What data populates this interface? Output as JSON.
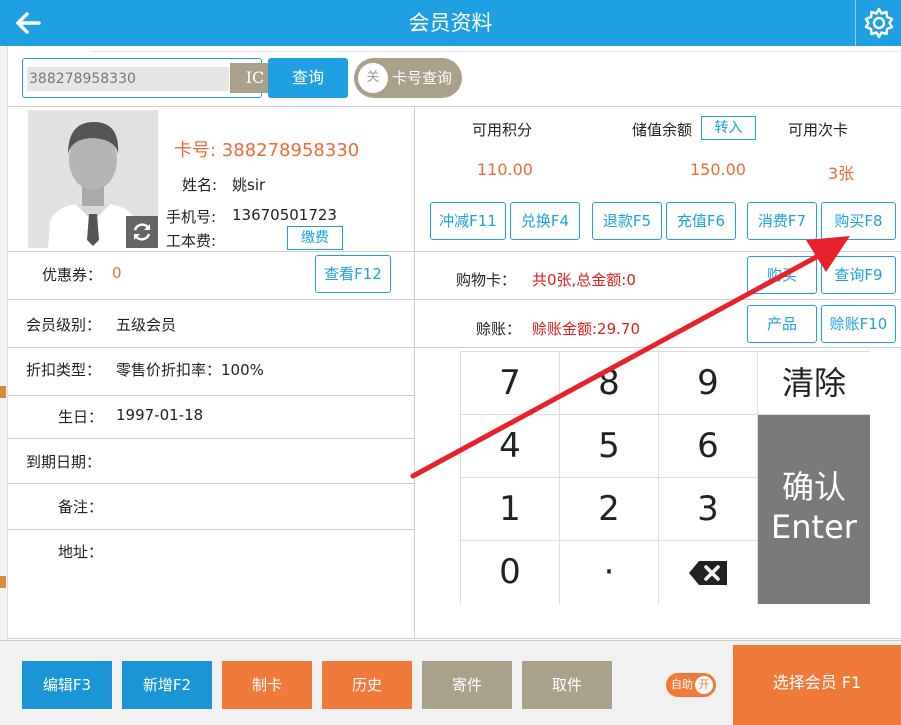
{
  "header": {
    "title": "会员资料"
  },
  "search": {
    "value": "388278958330",
    "ic_label": "IC",
    "query_label": "查询",
    "toggle_knob": "关",
    "toggle_label": "卡号查询"
  },
  "member": {
    "card_no": "卡号: 388278958330",
    "name_label": "姓名:",
    "name": "姚sir",
    "phone_label": "手机号:",
    "phone": "13670501723",
    "fee_label": "工本费:",
    "fee_button": "缴费"
  },
  "left": {
    "coupon_label": "优惠券：",
    "coupon_value": "0",
    "view_button": "查看F12",
    "level_label": "会员级别：",
    "level_value": "五级会员",
    "discount_label": "折扣类型：",
    "discount_value": "零售价折扣率：100%",
    "birthday_label": "生日：",
    "birthday_value": "1997-01-18",
    "expire_label": "到期日期：",
    "remark_label": "备注：",
    "address_label": "地址："
  },
  "stats": {
    "points_label": "可用积分",
    "points_value": "110.00",
    "balance_label": "储值余额",
    "transfer_button": "转入",
    "balance_value": "150.00",
    "cards_label": "可用次卡",
    "cards_value": "3张"
  },
  "actions": {
    "deduct": "冲减F11",
    "exchange": "兑换F4",
    "refund": "退款F5",
    "recharge": "充值F6",
    "consume": "消费F7",
    "buy": "购买F8",
    "cart_label": "购物卡：",
    "cart_value": "共0张,总金额:0",
    "cart_buy": "购买",
    "cart_query": "查询F9",
    "credit_label": "赊账：",
    "credit_value": "赊账金额:29.70",
    "product": "产品",
    "credit_button": "赊账F10"
  },
  "keypad": {
    "keys": [
      "7",
      "8",
      "9",
      "4",
      "5",
      "6",
      "1",
      "2",
      "3",
      "0",
      "·"
    ],
    "clear": "清除",
    "confirm_line1": "确认",
    "confirm_line2": "Enter"
  },
  "footer": {
    "edit": "编辑F3",
    "add": "新增F2",
    "make_card": "制卡",
    "history": "历史",
    "mail": "寄件",
    "pickup": "取件",
    "auto_label": "自助",
    "auto_state": "开",
    "select_member": "选择会员 F1"
  },
  "colors": {
    "primary": "#1ea0e2",
    "orange": "#f07a3a",
    "khaki": "#a9a18a",
    "red": "#e02020",
    "annotation_arrow": "#e8222a"
  },
  "icons": [
    "back-arrow-icon",
    "gear-icon",
    "refresh-icon",
    "backspace-icon",
    "avatar-placeholder-icon"
  ]
}
